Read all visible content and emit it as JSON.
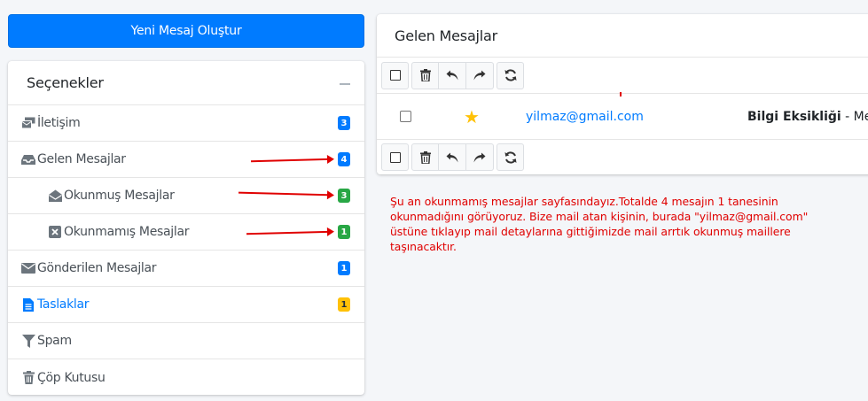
{
  "new_message_button": "Yeni Mesaj Oluştur",
  "sidebar": {
    "title": "Seçenekler",
    "items": [
      {
        "label": "İletişim",
        "icon": "envelopes-icon",
        "badge": "3",
        "badge_color": "#007bff"
      },
      {
        "label": "Gelen Mesajlar",
        "icon": "inbox-icon",
        "badge": "4",
        "badge_color": "#007bff"
      },
      {
        "label": "Okunmuş Mesajlar",
        "icon": "envelope-open-icon",
        "badge": "3",
        "badge_color": "#28a745"
      },
      {
        "label": "Okunmamış Mesajlar",
        "icon": "x-square-icon",
        "badge": "1",
        "badge_color": "#28a745"
      },
      {
        "label": "Gönderilen Mesajlar",
        "icon": "envelope-icon",
        "badge": "1",
        "badge_color": "#007bff"
      },
      {
        "label": "Taslaklar",
        "icon": "file-icon",
        "badge": "1",
        "badge_color": "#ffc107"
      },
      {
        "label": "Spam",
        "icon": "filter-icon"
      },
      {
        "label": "Çöp Kutusu",
        "icon": "trash-icon"
      }
    ]
  },
  "inbox": {
    "title": "Gelen Mesajlar",
    "messages": [
      {
        "from": "yilmaz@gmail.com",
        "subject": "Bilgi Eksikliği",
        "preview": " - Merh",
        "starred": true
      }
    ]
  },
  "annotation_note": "Şu an okunmamış mesajlar sayfasındayız.Totalde 4 mesajın 1 tanesinin okunmadığını görüyoruz. Bize mail atan kişinin, burada \"yilmaz@gmail.com\" üstüne tıklayıp mail detaylarına gittiğimizde mail arrtık okunmuş maillere taşınacaktır.",
  "colors": {
    "primary": "#007bff",
    "success": "#28a745",
    "warning": "#ffc107",
    "annotation": "#e00000"
  }
}
